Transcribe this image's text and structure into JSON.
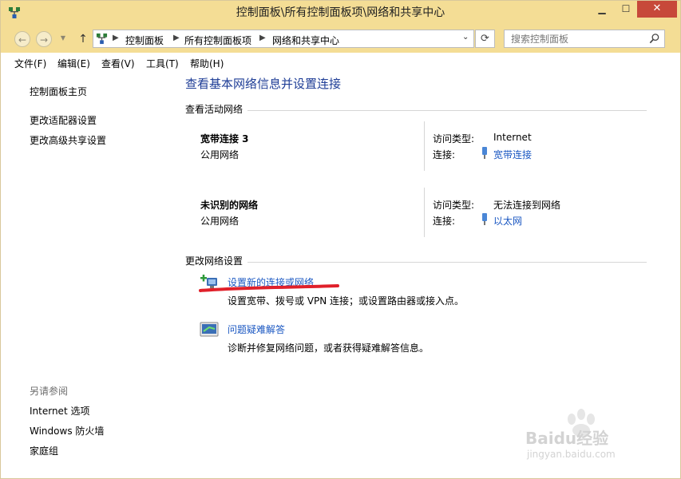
{
  "window": {
    "title": "控制面板\\所有控制面板项\\网络和共享中心"
  },
  "address": {
    "crumbs": [
      "控制面板",
      "所有控制面板项",
      "网络和共享中心"
    ]
  },
  "search": {
    "placeholder": "搜索控制面板"
  },
  "menu": [
    "文件(F)",
    "编辑(E)",
    "查看(V)",
    "工具(T)",
    "帮助(H)"
  ],
  "sidebar": {
    "links": [
      "控制面板主页",
      "更改适配器设置",
      "更改高级共享设置"
    ],
    "see_also_title": "另请参阅",
    "see_also": [
      "Internet 选项",
      "Windows 防火墙",
      "家庭组"
    ]
  },
  "main": {
    "title": "查看基本网络信息并设置连接",
    "active_title": "查看活动网络",
    "networks": [
      {
        "name": "宽带连接  3",
        "type": "公用网络",
        "access_label": "访问类型:",
        "access_value": "Internet",
        "conn_label": "连接:",
        "conn_value": "宽带连接"
      },
      {
        "name": "未识别的网络",
        "type": "公用网络",
        "access_label": "访问类型:",
        "access_value": "无法连接到网络",
        "conn_label": "连接:",
        "conn_value": "以太网"
      }
    ],
    "change_title": "更改网络设置",
    "tasks": [
      {
        "link": "设置新的连接或网络",
        "desc": "设置宽带、拨号或 VPN 连接；或设置路由器或接入点。"
      },
      {
        "link": "问题疑难解答",
        "desc": "诊断并修复网络问题，或者获得疑难解答信息。"
      }
    ]
  },
  "watermark": {
    "brand": "Baidu经验",
    "url": "jingyan.baidu.com"
  },
  "colors": {
    "titlebar": "#f4dd95",
    "link": "#1a57c2",
    "heading": "#1e3d96",
    "annotation": "#e0202a"
  }
}
